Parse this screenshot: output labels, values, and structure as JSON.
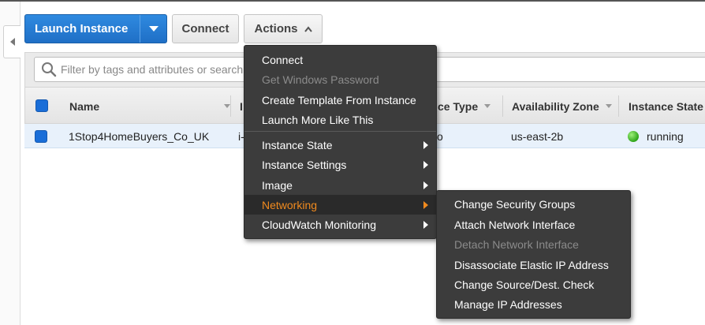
{
  "toolbar": {
    "launch_label": "Launch Instance",
    "connect_label": "Connect",
    "actions_label": "Actions"
  },
  "filter": {
    "placeholder": "Filter by tags and attributes or search by keyword"
  },
  "table": {
    "headers": [
      "Name",
      "Instance ID",
      "Instance Type",
      "Availability Zone",
      "Instance State"
    ],
    "visible_headers": {
      "name": "Name",
      "id_fragment": "I",
      "type_fragment": "ce Type",
      "zone": "Availability Zone",
      "state": "Instance State"
    },
    "rows": [
      {
        "name": "1Stop4HomeBuyers_Co_UK",
        "id_fragment": "i-",
        "type_fragment": "o",
        "zone": "us-east-2b",
        "state": "running"
      }
    ]
  },
  "actions_menu": {
    "items": [
      {
        "label": "Connect",
        "enabled": true
      },
      {
        "label": "Get Windows Password",
        "enabled": false
      },
      {
        "label": "Create Template From Instance",
        "enabled": true
      },
      {
        "label": "Launch More Like This",
        "enabled": true
      },
      {
        "label": "Instance State",
        "enabled": true,
        "submenu": true
      },
      {
        "label": "Instance Settings",
        "enabled": true,
        "submenu": true
      },
      {
        "label": "Image",
        "enabled": true,
        "submenu": true
      },
      {
        "label": "Networking",
        "enabled": true,
        "submenu": true,
        "active": true
      },
      {
        "label": "CloudWatch Monitoring",
        "enabled": true,
        "submenu": true
      }
    ]
  },
  "networking_submenu": {
    "items": [
      {
        "label": "Change Security Groups",
        "enabled": true
      },
      {
        "label": "Attach Network Interface",
        "enabled": true
      },
      {
        "label": "Detach Network Interface",
        "enabled": false
      },
      {
        "label": "Disassociate Elastic IP Address",
        "enabled": true
      },
      {
        "label": "Change Source/Dest. Check",
        "enabled": true
      },
      {
        "label": "Manage IP Addresses",
        "enabled": true
      }
    ]
  },
  "colors": {
    "primary_button": "#1f6fc6",
    "menu_background": "#3c3c3c",
    "menu_active_text": "#f08a1e",
    "menu_disabled_text": "#8b8b8b",
    "status_running": "#2fa51a",
    "selected_row": "#e8f1fb"
  },
  "icons": {
    "left_panel_toggle": "chevron-left-icon",
    "launch_dropdown": "caret-down-icon",
    "actions_toggle": "chevron-up-icon",
    "search": "search-icon",
    "status": "status-dot-icon",
    "submenu_indicator": "chevron-right-icon"
  }
}
